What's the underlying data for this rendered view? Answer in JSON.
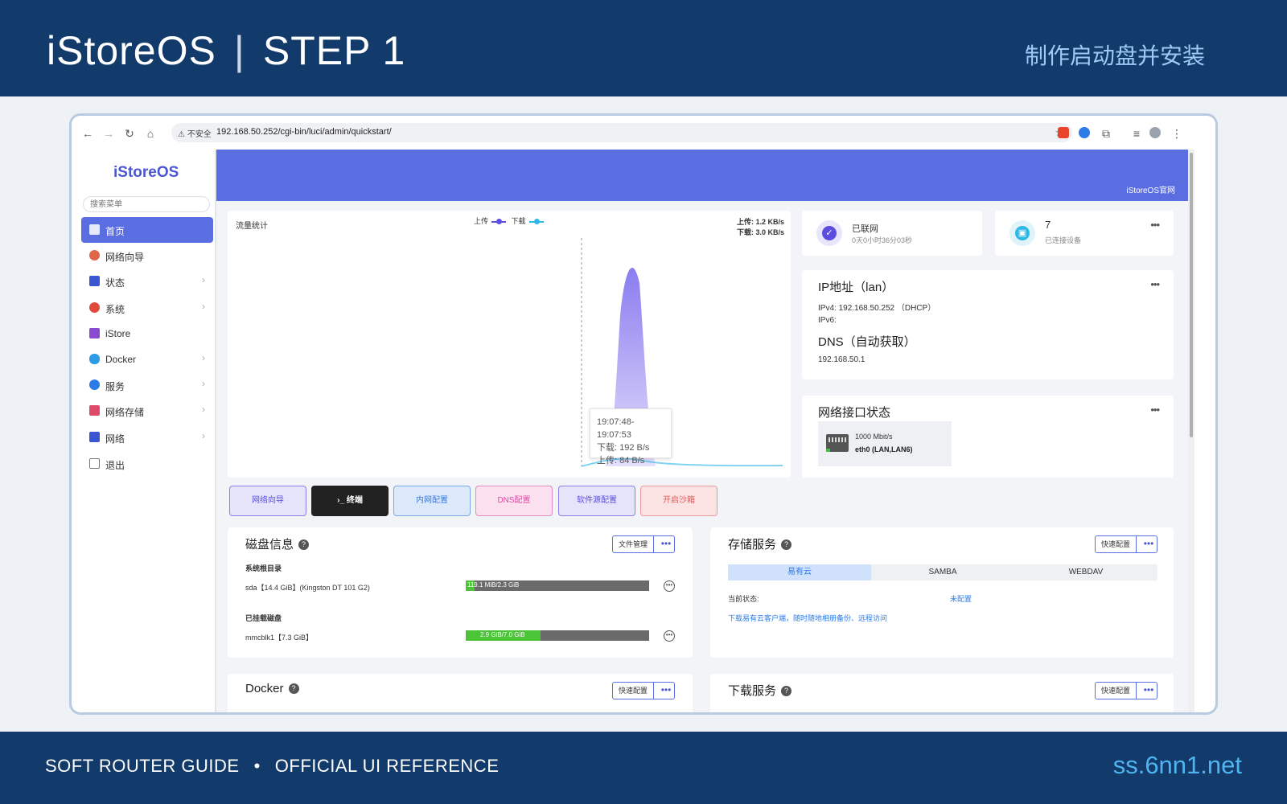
{
  "banner": {
    "brand": "iStoreOS",
    "separator": "|",
    "step": "STEP 1",
    "subtitle": "制作启动盘并安装",
    "footer_left_a": "SOFT ROUTER GUIDE",
    "footer_dot": "•",
    "footer_left_b": "OFFICIAL UI REFERENCE",
    "footer_right": "ss.6nn1.net"
  },
  "browser": {
    "security_label": "不安全",
    "url": "192.168.50.252/cgi-bin/luci/admin/quickstart/"
  },
  "sidebar": {
    "logo": "iStoreOS",
    "search_placeholder": "搜索菜单",
    "items": [
      {
        "label": "首页",
        "icon": "home-icon",
        "color": "#ffffff"
      },
      {
        "label": "网络向导",
        "icon": "wizard-icon",
        "color": "#e0664a"
      },
      {
        "label": "状态",
        "icon": "status-icon",
        "color": "#3a57d1"
      },
      {
        "label": "系统",
        "icon": "gear-icon",
        "color": "#e04a3a"
      },
      {
        "label": "iStore",
        "icon": "store-icon",
        "color": "#8a4ad1"
      },
      {
        "label": "Docker",
        "icon": "docker-icon",
        "color": "#2d9be6"
      },
      {
        "label": "服务",
        "icon": "services-icon",
        "color": "#2d7be6"
      },
      {
        "label": "网络存储",
        "icon": "storage-icon",
        "color": "#e04a6a"
      },
      {
        "label": "网络",
        "icon": "network-icon",
        "color": "#3a57d1"
      },
      {
        "label": "退出",
        "icon": "logout-icon",
        "color": "#777777"
      }
    ]
  },
  "header": {
    "official_link": "iStoreOS官网"
  },
  "traffic": {
    "title": "流量统计",
    "legend_up": "上传",
    "legend_down": "下载",
    "up_rate": "上传: 1.2 KB/s",
    "down_rate": "下载: 3.0 KB/s",
    "tooltip_time": "19:07:48-19:07:53",
    "tooltip_down": "下载: 192 B/s",
    "tooltip_up": "上传: 84 B/s",
    "up_color": "#5b4ee1",
    "down_color": "#2db8e6"
  },
  "status": {
    "online_label": "已联网",
    "uptime": "0天0小时36分03秒",
    "devices_count": "7",
    "devices_label": "已连接设备"
  },
  "ip": {
    "title": "IP地址（lan）",
    "ipv4_label": "IPv4:",
    "ipv4_value": "192.168.50.252 （DHCP）",
    "ipv6_label": "IPv6:",
    "dns_title": "DNS（自动获取）",
    "dns_value": "192.168.50.1"
  },
  "netif": {
    "title": "网络接口状态",
    "speed": "1000 Mbit/s",
    "name": "eth0 (LAN,LAN6)"
  },
  "quick_buttons": [
    {
      "label": "网络向导",
      "bg": "#e6e4fb",
      "border": "#8a7ee8",
      "color": "#5b4ee1"
    },
    {
      "label": "›_ 终端",
      "bg": "#222222",
      "border": "#222222",
      "color": "#ffffff"
    },
    {
      "label": "内网配置",
      "bg": "#dbe9fb",
      "border": "#7aa7e6",
      "color": "#3a7be0"
    },
    {
      "label": "DNS配置",
      "bg": "#fbe1f0",
      "border": "#e28bbf",
      "color": "#e04aa0"
    },
    {
      "label": "软件源配置",
      "bg": "#e6e4fb",
      "border": "#8a7ee8",
      "color": "#5b4ee1"
    },
    {
      "label": "开启沙箱",
      "bg": "#fbe3e3",
      "border": "#e89a9a",
      "color": "#e05a5a"
    }
  ],
  "disk": {
    "title": "磁盘信息",
    "file_mgr": "文件管理",
    "root_label": "系统根目录",
    "root_name": "sda【14.4 GiB】(Kingston DT 101 G2)",
    "root_usage": "119.1 MiB/2.3 GiB",
    "root_frac": 0.05,
    "mounted_label": "已挂载磁盘",
    "mounted_name": "mmcblk1【7.3 GiB】",
    "mounted_usage": "2.9 GiB/7.0 GiB",
    "mounted_frac": 0.41
  },
  "storage": {
    "title": "存储服务",
    "quick": "快速配置",
    "tabs": [
      "易有云",
      "SAMBA",
      "WEBDAV"
    ],
    "status_label": "当前状态:",
    "status_value": "未配置",
    "link": "下载易有云客户端，随时随地相册备份、远程访问"
  },
  "docker": {
    "title": "Docker",
    "quick": "快速配置"
  },
  "download": {
    "title": "下载服务",
    "quick": "快速配置"
  },
  "more_glyph": "•••",
  "help_glyph": "?"
}
